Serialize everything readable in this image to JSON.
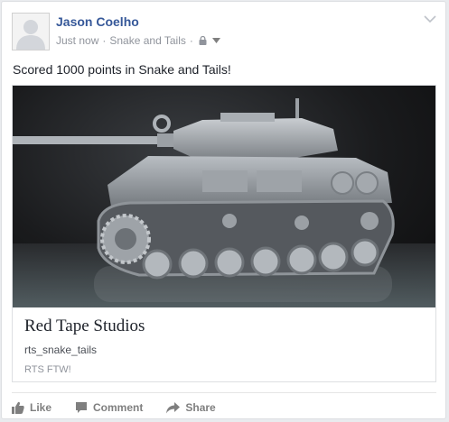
{
  "post": {
    "author": "Jason Coelho",
    "time": "Just now",
    "separator": "·",
    "app": "Snake and Tails",
    "privacy_icon": "lock-icon",
    "menu_icon": "chevron-down-icon",
    "status_text": "Scored 1000 points in Snake and Tails!"
  },
  "attachment": {
    "image_icon": "tank-image",
    "title": "Red Tape Studios",
    "domain": "rts_snake_tails",
    "description": "RTS FTW!"
  },
  "actions": [
    {
      "label": "Like",
      "icon": "thumbs-up-icon"
    },
    {
      "label": "Comment",
      "icon": "comment-icon"
    },
    {
      "label": "Share",
      "icon": "share-icon"
    }
  ],
  "colors": {
    "author_link": "#365899",
    "meta_text": "#90949c",
    "action_text": "#7f7f7f"
  }
}
